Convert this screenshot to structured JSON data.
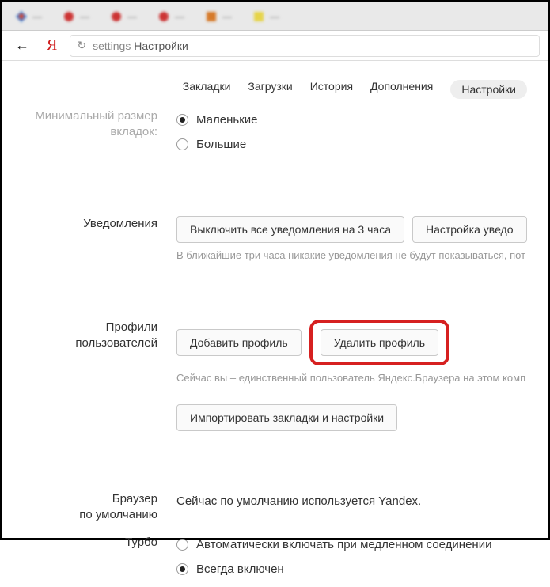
{
  "tabs": [
    {
      "icon": "diamond",
      "label": "—"
    },
    {
      "icon": "dot-red",
      "label": "—"
    },
    {
      "icon": "dot-red",
      "label": "—"
    },
    {
      "icon": "dot-red",
      "label": "—"
    },
    {
      "icon": "square",
      "label": "—"
    },
    {
      "icon": "square-yellow",
      "label": "—"
    }
  ],
  "toolbar": {
    "url_prefix": "settings",
    "url_rest": "Настройки"
  },
  "nav": {
    "bookmarks": "Закладки",
    "downloads": "Загрузки",
    "history": "История",
    "addons": "Дополнения",
    "settings": "Настройки"
  },
  "tab_size": {
    "label_line1": "Минимальный размер",
    "label_line2": "вкладок:",
    "small": "Маленькие",
    "large": "Большие"
  },
  "notifications": {
    "label": "Уведомления",
    "mute_btn": "Выключить все уведомления на 3 часа",
    "settings_btn": "Настройка уведо",
    "hint": "В ближайшие три часа никакие уведомления не будут показываться, пот"
  },
  "profiles": {
    "label_line1": "Профили",
    "label_line2": "пользователей",
    "add_btn": "Добавить профиль",
    "remove_btn": "Удалить профиль",
    "hint": "Сейчас вы – единственный пользователь Яндекс.Браузера на этом комп",
    "import_btn": "Импортировать закладки и настройки"
  },
  "default_browser": {
    "label_line1": "Браузер",
    "label_line2": "по умолчанию",
    "status": "Сейчас по умолчанию используется Yandex."
  },
  "turbo": {
    "label": "Турбо",
    "auto": "Автоматически включать при медленном соединении",
    "always": "Всегда включен"
  }
}
